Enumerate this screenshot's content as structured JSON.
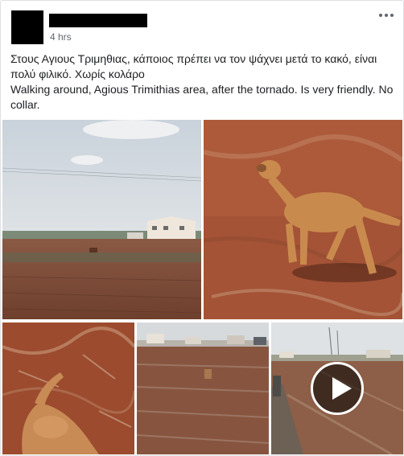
{
  "post": {
    "timestamp": "4 hrs",
    "text_greek": "Στους Αγιους Τριμηθιας, κάποιος πρέπει να τον ψάχνει μετά το κακό, είναι πολύ φιλικό. Χωρίς κολάρο",
    "text_english": "Walking around, Agious Trimithias area, after the tornado. Is very friendly. No collar."
  },
  "icons": {
    "more": "more-horizontal-icon",
    "play": "play-icon"
  }
}
